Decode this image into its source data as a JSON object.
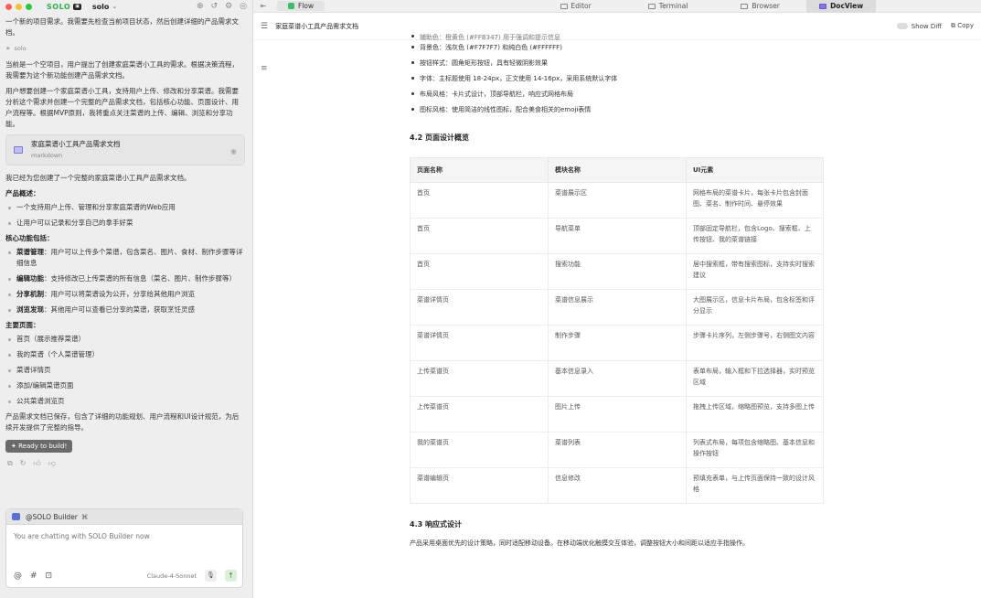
{
  "titlebar": {
    "logo": "SOLO",
    "workspace": "solo"
  },
  "chat": {
    "intro": "一个新的项目需求。我需要先检查当前项目状态，然后创建详细的产品需求文档。",
    "agent": "solo",
    "p1": "当前是一个空项目，用户提出了创建家庭菜谱小工具的需求。根据决策流程，我需要为这个新功能创建产品需求文档。",
    "p2": "用户想要创建一个家庭菜谱小工具，支持用户上传、修改和分享菜谱。我需要分析这个需求并创建一个完整的产品需求文档，包括核心功能、页面设计、用户流程等。根据MVP原则，我将重点关注菜谱的上传、编辑、浏览和分享功能。",
    "file_card": {
      "title": "家庭菜谱小工具产品需求文档",
      "type": "markdown"
    },
    "created": "我已经为您创建了一个完整的家庭菜谱小工具产品需求文档。",
    "overview_title": "产品概述：",
    "overview": [
      "一个支持用户上传、管理和分享家庭菜谱的Web应用",
      "让用户可以记录和分享自己的拿手好菜"
    ],
    "core_title": "核心功能包括：",
    "core": [
      {
        "bold": "菜谱管理",
        "text": "：用户可以上传多个菜谱，包含菜名、图片、食材、制作步骤等详细信息"
      },
      {
        "bold": "编辑功能",
        "text": "：支持修改已上传菜谱的所有信息（菜名、图片、制作步骤等）"
      },
      {
        "bold": "分享机制",
        "text": "：用户可以将菜谱设为公开，分享给其他用户浏览"
      },
      {
        "bold": "浏览发现",
        "text": "：其他用户可以查看已分享的菜谱，获取烹饪灵感"
      }
    ],
    "pages_title": "主要页面：",
    "pages": [
      "首页（展示推荐菜谱）",
      "我的菜谱（个人菜谱管理）",
      "菜谱详情页",
      "添加/编辑菜谱页面",
      "公共菜谱浏览页"
    ],
    "closing": "产品需求文档已保存，包含了详细的功能规划、用户流程和UI设计规范，为后续开发提供了完整的指导。",
    "ready_label": "Ready to build!"
  },
  "builder": {
    "title": "@SOLO Builder",
    "placeholder": "You are chatting with SOLO Builder now",
    "model": "Claude-4-Sonnet"
  },
  "tabs": {
    "flow": "Flow",
    "editor": "Editor",
    "terminal": "Terminal",
    "browser": "Browser",
    "docview": "DocView"
  },
  "doc_header": {
    "title": "家庭菜谱小工具产品需求文档",
    "show_diff": "Show Diff",
    "copy": "Copy"
  },
  "doc": {
    "style_items": [
      "辅助色：橙黄色 (#FFB347) 用于强调和提示信息",
      "背景色：浅灰色 (#F7F7F7) 和纯白色 (#FFFFFF)",
      "按钮样式：圆角矩形按钮，具有轻微阴影效果",
      "字体：主标题使用 18-24px，正文使用 14-16px，采用系统默认字体",
      "布局风格：卡片式设计，顶部导航栏，响应式网格布局",
      "图标风格：使用简洁的线性图标，配合美食相关的emoji表情"
    ],
    "h42": "4.2 页面设计概览",
    "table_headers": [
      "页面名称",
      "模块名称",
      "UI元素"
    ],
    "table_rows": [
      [
        "首页",
        "菜谱展示区",
        "网格布局的菜谱卡片，每张卡片包含封面图、菜名、制作时间、悬停效果"
      ],
      [
        "首页",
        "导航菜单",
        "顶部固定导航栏，包含Logo、搜索框、上传按钮、我的菜谱链接"
      ],
      [
        "首页",
        "搜索功能",
        "居中搜索框，带有搜索图标，支持实时搜索建议"
      ],
      [
        "菜谱详情页",
        "菜谱信息展示",
        "大图展示区，信息卡片布局，包含标签和评分显示"
      ],
      [
        "菜谱详情页",
        "制作步骤",
        "步骤卡片序列，左侧步骤号，右侧图文内容"
      ],
      [
        "上传菜谱页",
        "基本信息录入",
        "表单布局，输入框和下拉选择器，实时预览区域"
      ],
      [
        "上传菜谱页",
        "图片上传",
        "拖拽上传区域，缩略图预览，支持多图上传"
      ],
      [
        "我的菜谱页",
        "菜谱列表",
        "列表式布局，每项包含缩略图、基本信息和操作按钮"
      ],
      [
        "菜谱编辑页",
        "信息修改",
        "预填充表单，与上传页面保持一致的设计风格"
      ]
    ],
    "h43": "4.3 响应式设计",
    "responsive": "产品采用桌面优先的设计策略，同时适配移动设备。在移动端优化触摸交互体验，调整按钮大小和间距以适应手指操作。"
  }
}
